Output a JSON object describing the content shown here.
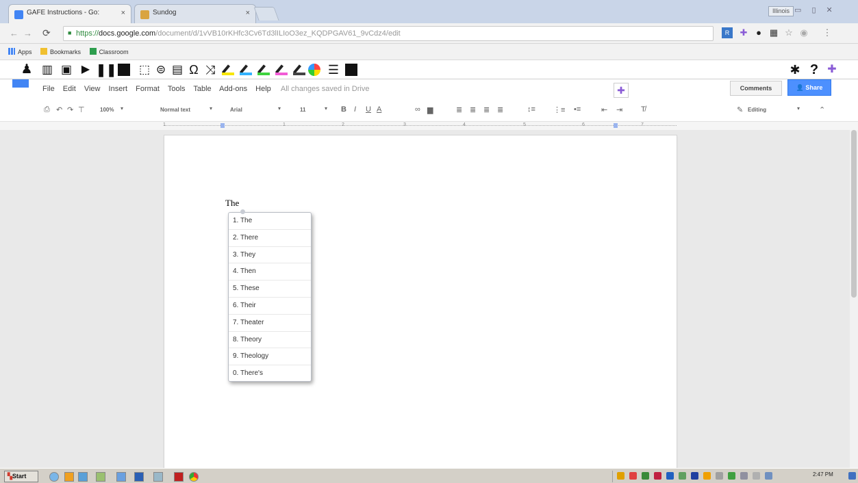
{
  "browser": {
    "tabs": [
      {
        "title": "GAFE Instructions - Go:",
        "close": "×",
        "active": true
      },
      {
        "title": "Sundog",
        "close": "×",
        "active": false
      }
    ],
    "user": "Illinois",
    "window_buttons": "▭ ▯ ✕",
    "url": {
      "scheme": "https://",
      "host": "docs.google.com",
      "path": "/document/d/1vVB10rKHfc3Cv6Td3lILIoO3ez_KQDPGAV61_9vCdz4/edit"
    },
    "bookmarks": [
      "Apps",
      "Bookmarks",
      "Classroom"
    ]
  },
  "docs": {
    "menu": [
      "File",
      "Edit",
      "View",
      "Insert",
      "Format",
      "Tools",
      "Table",
      "Add-ons",
      "Help"
    ],
    "save_status": "All changes saved in Drive",
    "comments_label": "Comments",
    "share_label": "Share",
    "toolbar": {
      "zoom": "100%",
      "style": "Normal text",
      "font": "Arial",
      "size": "11",
      "mode": "Editing"
    },
    "ruler_numbers": [
      "1",
      "1",
      "2",
      "3",
      "4",
      "5",
      "6",
      "7"
    ],
    "document_text": "The"
  },
  "prediction": {
    "items": [
      "1. The",
      "2. There",
      "3. They",
      "4. Then",
      "5. These",
      "6. Their",
      "7. Theater",
      "8. Theory",
      "9. Theology",
      "0. There's"
    ]
  },
  "taskbar": {
    "start_label": "Start",
    "clock": "2:47 PM"
  },
  "colors": {
    "docs_blue": "#4285f4",
    "share_blue": "#4d90fe",
    "extension_purple": "#8a5cd6"
  }
}
